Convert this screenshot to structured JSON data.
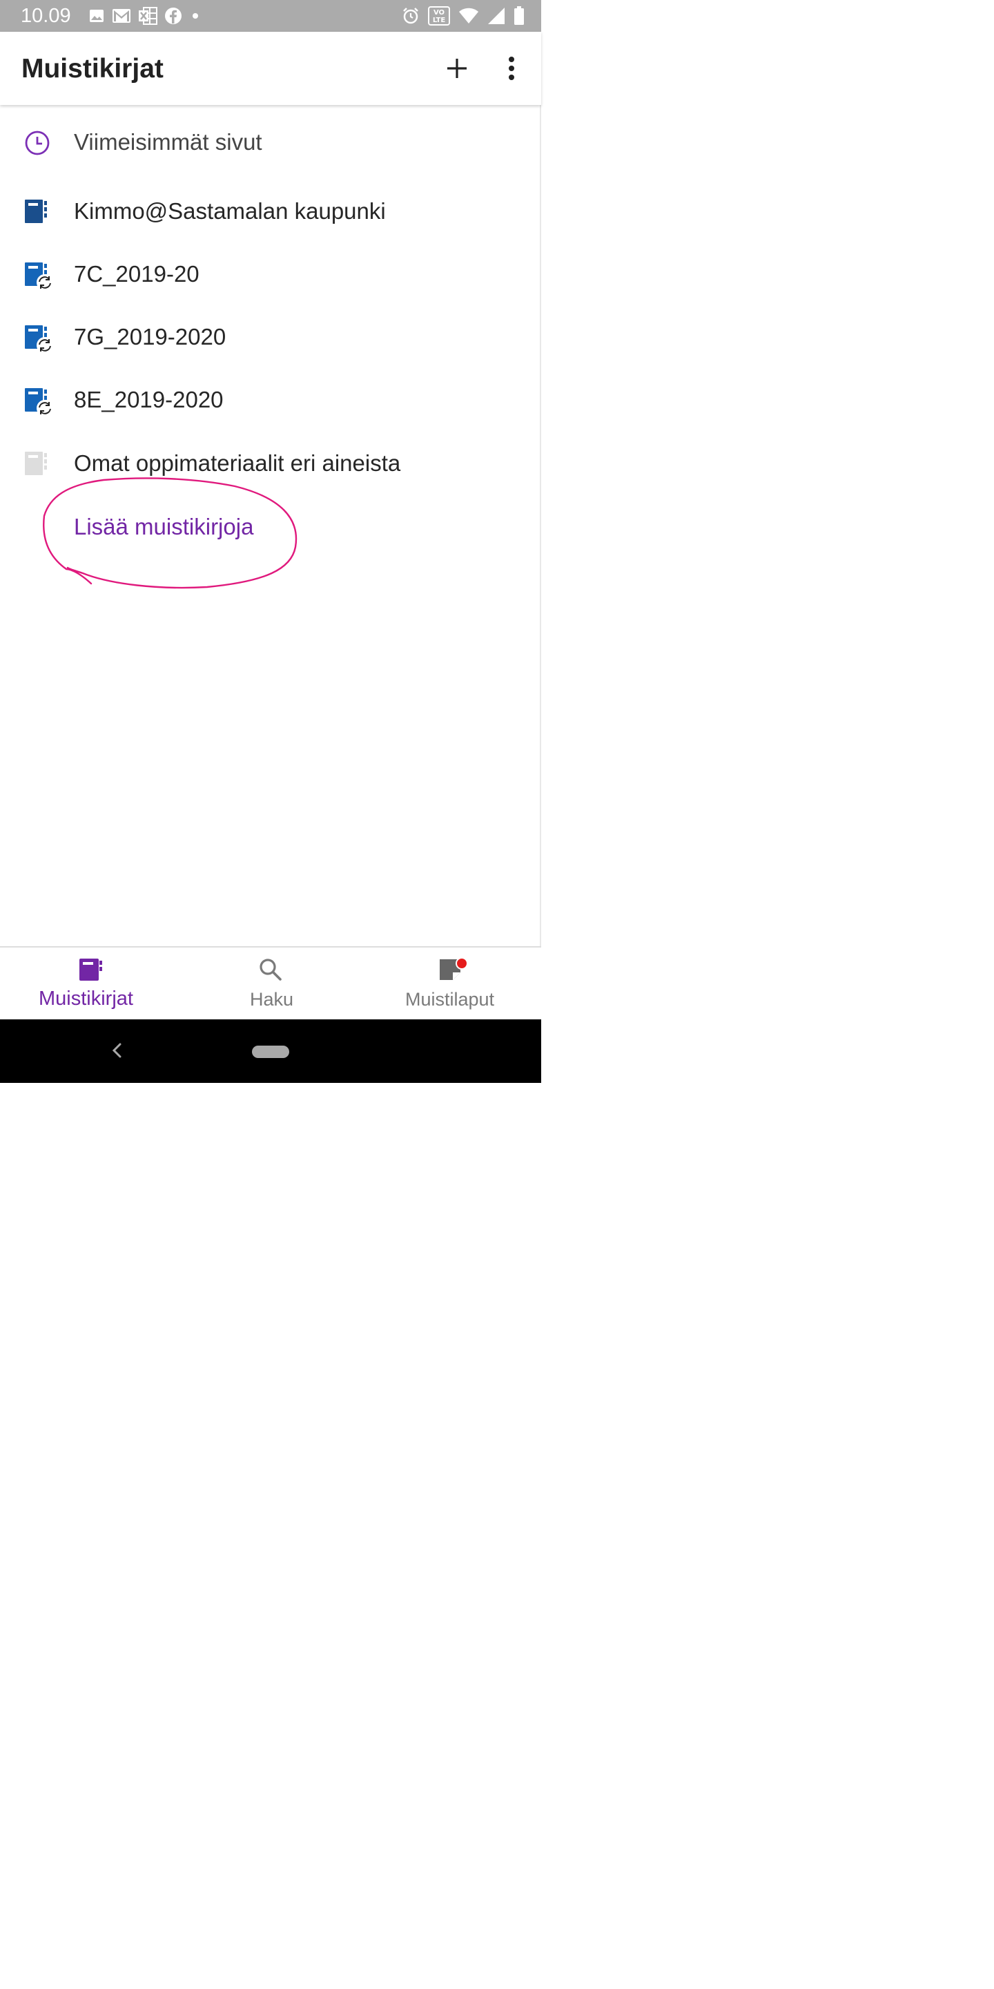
{
  "status_bar": {
    "time": "10.09",
    "left_icons": [
      "image-icon",
      "gmail-icon",
      "excel-icon",
      "facebook-icon",
      "dot-icon"
    ],
    "right_icons": [
      "alarm-icon",
      "volte-icon",
      "wifi-icon",
      "signal-icon",
      "battery-icon"
    ],
    "volte_text": "VO LTE"
  },
  "app_bar": {
    "title": "Muistikirjat",
    "actions": [
      "plus-icon",
      "more-vertical-icon"
    ]
  },
  "list": {
    "recent": {
      "label": "Viimeisimmät sivut",
      "icon": "clock-icon",
      "color": "#7b2fb5"
    },
    "notebooks": [
      {
        "label": "Kimmo@Sastamalan kaupunki",
        "icon": "notebook-icon",
        "color": "#1a4e8c",
        "syncing": false
      },
      {
        "label": "7C_2019-20",
        "icon": "notebook-sync-icon",
        "color": "#1565b8",
        "syncing": true
      },
      {
        "label": "7G_2019-2020",
        "icon": "notebook-sync-icon",
        "color": "#1565b8",
        "syncing": true
      },
      {
        "label": "8E_2019-2020",
        "icon": "notebook-sync-icon",
        "color": "#1565b8",
        "syncing": true
      },
      {
        "label": "Omat oppimateriaalit eri aineista",
        "icon": "notebook-icon",
        "color": "#dddddd",
        "syncing": false
      }
    ],
    "add_more_link": "Lisää muistikirjoja",
    "annotation_color": "#e0197d"
  },
  "bottom_nav": {
    "items": [
      {
        "label": "Muistikirjat",
        "icon": "notebook-icon",
        "active": true
      },
      {
        "label": "Haku",
        "icon": "search-icon",
        "active": false
      },
      {
        "label": "Muistilaput",
        "icon": "sticky-note-icon",
        "active": false,
        "badge": true
      }
    ],
    "active_color": "#7226a5",
    "inactive_color": "#7a7a7a",
    "badge_color": "#e51b1b"
  }
}
